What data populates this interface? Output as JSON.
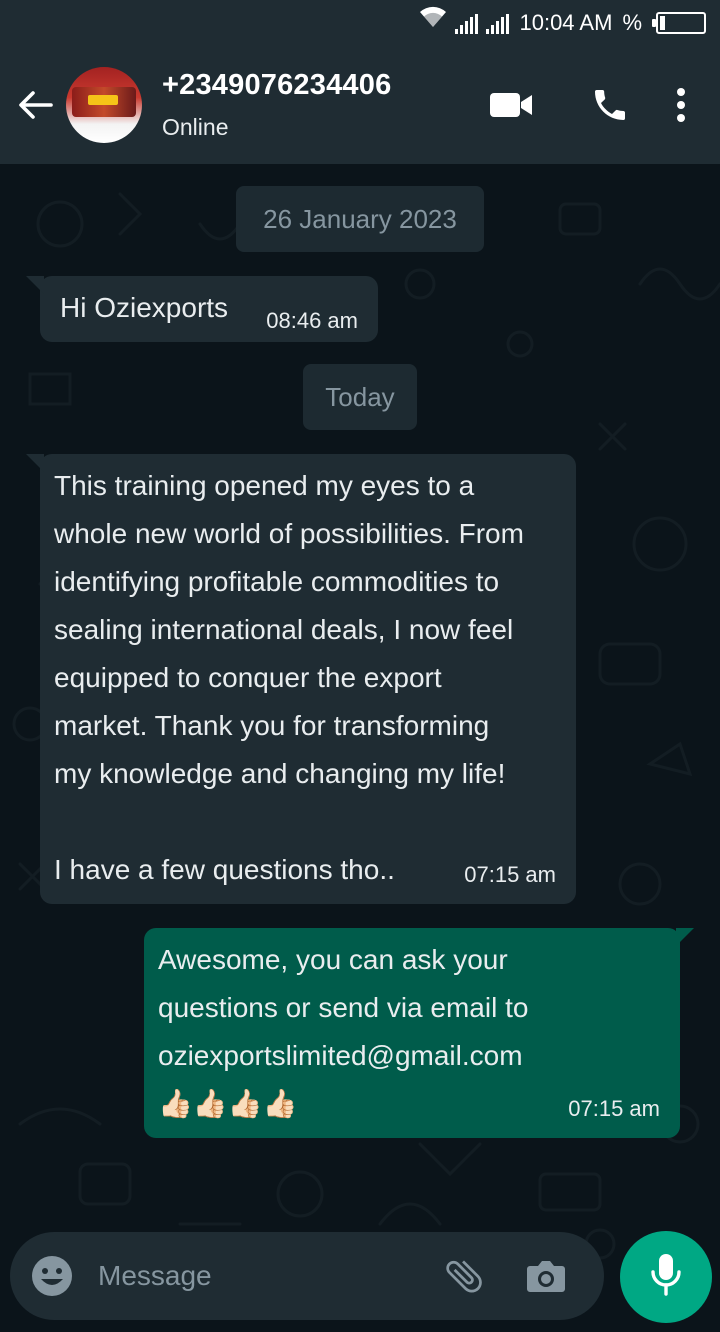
{
  "status_bar": {
    "time": "10:04 AM",
    "battery_symbol": "%",
    "icons": [
      "wifi-icon",
      "signal-icon",
      "signal-icon",
      "battery-icon"
    ]
  },
  "header": {
    "contact_name": "+2349076234406",
    "status": "Online",
    "icons": [
      "back-arrow-icon",
      "video-call-icon",
      "phone-icon",
      "more-vert-icon"
    ]
  },
  "chat": {
    "date_chips": [
      "26 January 2023",
      "Today"
    ],
    "messages": [
      {
        "direction": "incoming",
        "text": "Hi Oziexports",
        "time": "08:46 am"
      },
      {
        "direction": "incoming",
        "text": " This training opened my eyes to a\nwhole new world of possibilities. From\nidentifying profitable commodities to\nsealing international deals, I now feel\nequipped to conquer the export\nmarket. Thank you for transforming\nmy knowledge and changing my life!\n\nI have a few questions tho..",
        "time": "07:15 am"
      },
      {
        "direction": "outgoing",
        "text": " Awesome, you can ask your\nquestions or send via email to\noziexportslimited@gmail.com\n👍🏻👍🏻👍🏻👍🏻",
        "time": "07:15 am"
      }
    ]
  },
  "input": {
    "placeholder": "Message",
    "icons": [
      "emoji-icon",
      "attach-icon",
      "camera-icon",
      "mic-icon"
    ]
  },
  "colors": {
    "header_bg": "#1f2c33",
    "chat_bg": "#0b141a",
    "incoming_bubble": "#1f2c33",
    "outgoing_bubble": "#005c4b",
    "accent": "#00a884"
  }
}
